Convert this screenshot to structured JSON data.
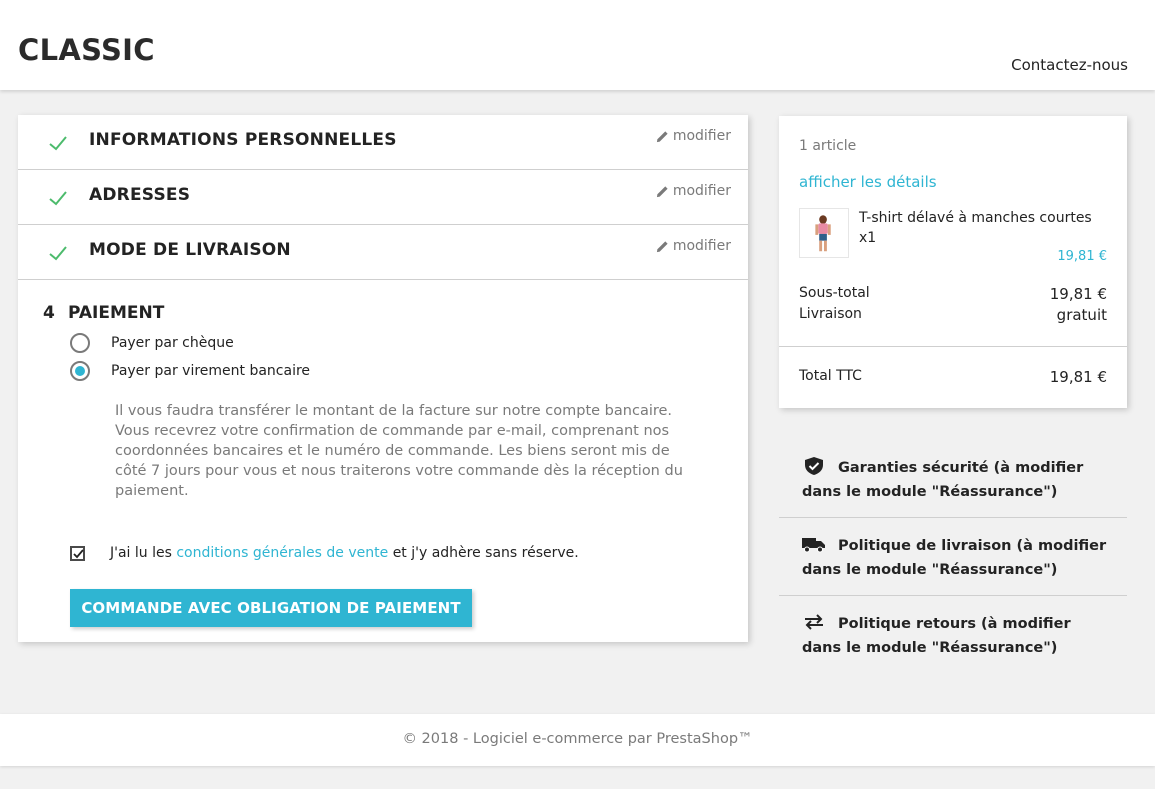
{
  "header": {
    "logo": "CLASSIC",
    "contact_label": "Contactez-nous"
  },
  "steps": [
    {
      "title": "INFORMATIONS PERSONNELLES",
      "edit_label": "modifier",
      "icon": "check-icon"
    },
    {
      "title": "ADRESSES",
      "edit_label": "modifier",
      "icon": "check-icon"
    },
    {
      "title": "MODE DE LIVRAISON",
      "edit_label": "modifier",
      "icon": "check-icon"
    }
  ],
  "payment": {
    "step_number": "4",
    "title": "PAIEMENT",
    "options": [
      {
        "label": "Payer par chèque",
        "selected": false
      },
      {
        "label": "Payer par virement bancaire",
        "selected": true
      }
    ],
    "info_text": "Il vous faudra transférer le montant de la facture sur notre compte bancaire. Vous recevrez votre confirmation de commande par e-mail, comprenant nos coordonnées bancaires et le numéro de commande. Les biens seront mis de côté 7 jours pour vous et nous traiterons votre commande dès la réception du paiement.",
    "terms_prefix": "J'ai lu les",
    "terms_link": "conditions générales de vente",
    "terms_suffix": "et j'y adhère sans réserve.",
    "terms_checked": true,
    "order_button": "COMMANDE AVEC OBLIGATION DE PAIEMENT"
  },
  "summary": {
    "item_count": "1 article",
    "details_link": "afficher les détails",
    "product": {
      "name": "T-shirt délavé à manches courtes",
      "qty": "x1",
      "price": "19,81 €"
    },
    "subtotal_label": "Sous-total",
    "subtotal_value": "19,81 €",
    "shipping_label": "Livraison",
    "shipping_value": "gratuit",
    "total_label": "Total TTC",
    "total_value": "19,81 €"
  },
  "reassurance": [
    {
      "icon": "shield-check-icon",
      "text": "Garanties sécurité (à modifier dans le module \"Réassurance\")"
    },
    {
      "icon": "truck-icon",
      "text": "Politique de livraison (à modifier dans le module \"Réassurance\")"
    },
    {
      "icon": "swap-arrows-icon",
      "text": "Politique retours (à modifier dans le module \"Réassurance\")"
    }
  ],
  "footer": {
    "text": "© 2018 - Logiciel e-commerce par PrestaShop™"
  },
  "colors": {
    "accent": "#2fb5d2",
    "check": "#4cbb6c",
    "muted": "#7a7a7a",
    "background": "#f1f1f1"
  }
}
